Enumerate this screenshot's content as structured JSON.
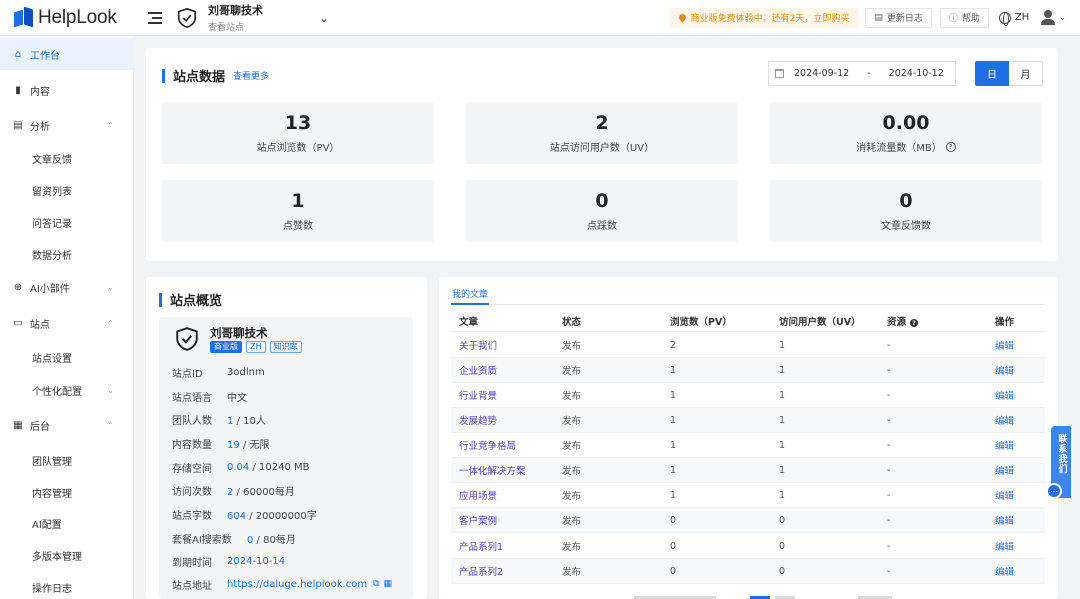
{
  "brand": {
    "logo_text": "HelpLook",
    "accent": "#1f6fe5"
  },
  "header": {
    "site_name": "刘哥聊技术",
    "site_sub": "查看站点",
    "promo": "商业版免费体验中，还有2天，立即购买",
    "changelog": "更新日志",
    "help": "帮助",
    "language": "ZH"
  },
  "sidebar": {
    "items": [
      {
        "label": "工作台",
        "icon": "home-icon"
      },
      {
        "label": "内容",
        "icon": "book-icon"
      },
      {
        "label": "分析",
        "icon": "chart-icon"
      },
      {
        "label": "文章反馈"
      },
      {
        "label": "留资列表"
      },
      {
        "label": "问答记录"
      },
      {
        "label": "数据分析"
      },
      {
        "label": "AI小部件",
        "icon": "plus-circle-icon"
      },
      {
        "label": "站点",
        "icon": "monitor-icon"
      },
      {
        "label": "站点设置"
      },
      {
        "label": "个性化配置"
      },
      {
        "label": "后台",
        "icon": "grid-icon"
      },
      {
        "label": "团队管理"
      },
      {
        "label": "内容管理"
      },
      {
        "label": "AI配置"
      },
      {
        "label": "多版本管理"
      },
      {
        "label": "操作日志"
      }
    ]
  },
  "site_data": {
    "title": "站点数据",
    "more_link": "查看更多",
    "date_start": "2024-09-12",
    "date_sep": "-",
    "date_end": "2024-10-12",
    "granularity_day": "日",
    "granularity_month": "月",
    "stats": [
      {
        "value": "13",
        "label": "站点浏览数（PV）"
      },
      {
        "value": "2",
        "label": "站点访问用户数（UV）"
      },
      {
        "value": "0.00",
        "label": "消耗流量数（MB）"
      },
      {
        "value": "1",
        "label": "点赞数"
      },
      {
        "value": "0",
        "label": "点踩数"
      },
      {
        "value": "0",
        "label": "文章反馈数"
      }
    ]
  },
  "overview": {
    "title": "站点概览",
    "site_name": "刘哥聊技术",
    "tags": [
      "商业版",
      "ZH",
      "知识库"
    ],
    "rows": [
      {
        "key": "站点ID",
        "value": "3odlnm"
      },
      {
        "key": "站点语言",
        "value": "中文"
      },
      {
        "key": "团队人数",
        "used": "1",
        "total": " / 10人"
      },
      {
        "key": "内容数量",
        "used": "19",
        "total": " / 无限"
      },
      {
        "key": "存储空间",
        "used": "0.04",
        "total": " / 10240 MB"
      },
      {
        "key": "访问次数",
        "used": "2",
        "total": " / 60000每月"
      },
      {
        "key": "站点字数",
        "used": "604",
        "total": " / 20000000字"
      },
      {
        "key": "套餐AI搜索数",
        "used": "0",
        "total": " / 80每月"
      },
      {
        "key": "到期时间",
        "value": "2024-10-14"
      },
      {
        "key": "站点地址",
        "value": "https://daluge.helplook.com"
      }
    ]
  },
  "articles": {
    "tab": "我的文章",
    "columns": [
      "文章",
      "状态",
      "浏览数（PV）",
      "访问用户数（UV）",
      "资源",
      "操作"
    ],
    "rows": [
      {
        "title": "关于我们",
        "status": "发布",
        "pv": "2",
        "uv": "1",
        "res": "-",
        "action": "编辑"
      },
      {
        "title": "企业资质",
        "status": "发布",
        "pv": "1",
        "uv": "1",
        "res": "-",
        "action": "编辑"
      },
      {
        "title": "行业背景",
        "status": "发布",
        "pv": "1",
        "uv": "1",
        "res": "-",
        "action": "编辑"
      },
      {
        "title": "发展趋势",
        "status": "发布",
        "pv": "1",
        "uv": "1",
        "res": "-",
        "action": "编辑"
      },
      {
        "title": "行业竞争格局",
        "status": "发布",
        "pv": "1",
        "uv": "1",
        "res": "-",
        "action": "编辑"
      },
      {
        "title": "一体化解决方案",
        "status": "发布",
        "pv": "1",
        "uv": "1",
        "res": "-",
        "action": "编辑"
      },
      {
        "title": "应用场景",
        "status": "发布",
        "pv": "1",
        "uv": "1",
        "res": "-",
        "action": "编辑"
      },
      {
        "title": "客户案例",
        "status": "发布",
        "pv": "0",
        "uv": "0",
        "res": "-",
        "action": "编辑"
      },
      {
        "title": "产品系列1",
        "status": "发布",
        "pv": "0",
        "uv": "0",
        "res": "-",
        "action": "编辑"
      },
      {
        "title": "产品系列2",
        "status": "发布",
        "pv": "0",
        "uv": "0",
        "res": "-",
        "action": "编辑"
      }
    ]
  },
  "contact": {
    "label": "联系我们"
  }
}
